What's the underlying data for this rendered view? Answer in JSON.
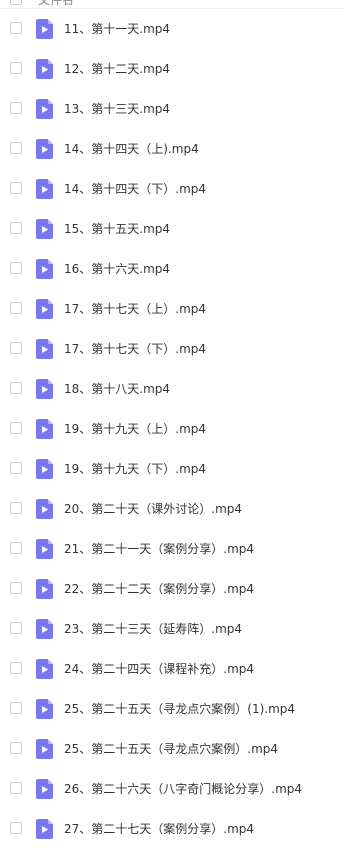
{
  "header": {
    "column_label": "文件名"
  },
  "icons": {
    "row_checkbox": "checkbox-icon",
    "file_type": "video-file-icon",
    "video_icon_color": "#7b77f0"
  },
  "files": [
    {
      "name": "11、第十一天.mp4"
    },
    {
      "name": "12、第十二天.mp4"
    },
    {
      "name": "13、第十三天.mp4"
    },
    {
      "name": "14、第十四天（上).mp4"
    },
    {
      "name": "14、第十四天（下）.mp4"
    },
    {
      "name": "15、第十五天.mp4"
    },
    {
      "name": "16、第十六天.mp4"
    },
    {
      "name": "17、第十七天（上）.mp4"
    },
    {
      "name": "17、第十七天（下）.mp4"
    },
    {
      "name": "18、第十八天.mp4"
    },
    {
      "name": "19、第十九天（上）.mp4"
    },
    {
      "name": "19、第十九天（下）.mp4"
    },
    {
      "name": "20、第二十天（课外讨论）.mp4"
    },
    {
      "name": "21、第二十一天（案例分享）.mp4"
    },
    {
      "name": "22、第二十二天（案例分享）.mp4"
    },
    {
      "name": "23、第二十三天（延寿阵）.mp4"
    },
    {
      "name": "24、第二十四天（课程补充）.mp4"
    },
    {
      "name": "25、第二十五天（寻龙点穴案例）(1).mp4"
    },
    {
      "name": "25、第二十五天（寻龙点穴案例）.mp4"
    },
    {
      "name": "26、第二十六天（八字奇门概论分享）.mp4"
    },
    {
      "name": "27、第二十七天（案例分享）.mp4"
    }
  ]
}
